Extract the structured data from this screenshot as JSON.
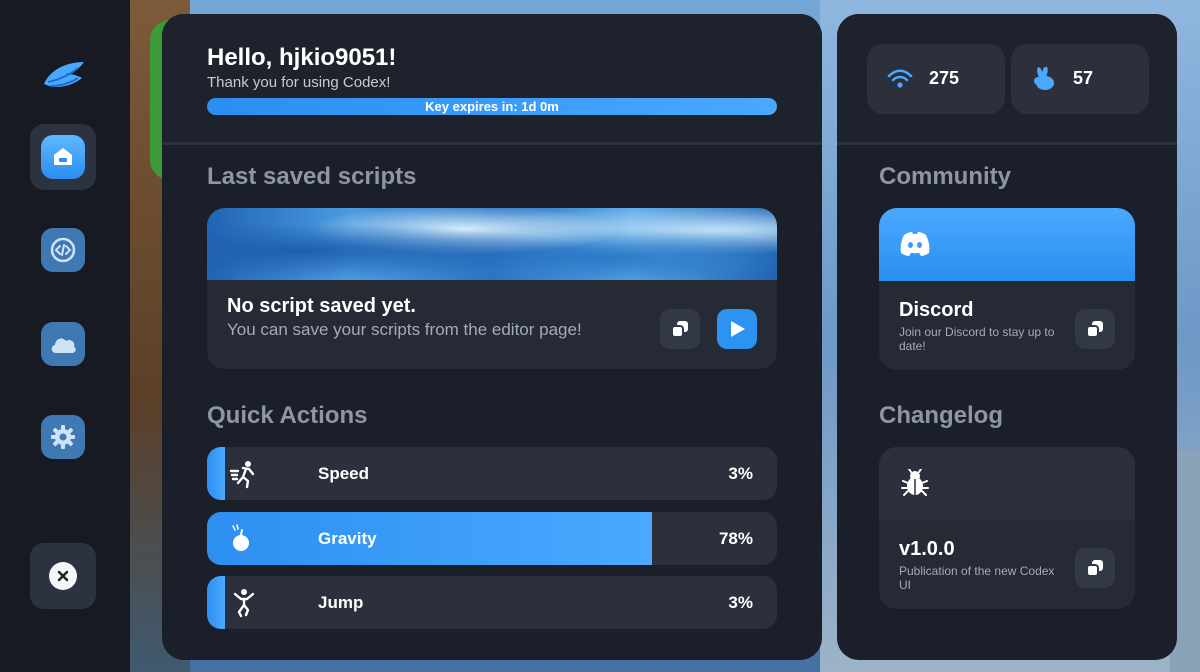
{
  "greeting": "Hello, hjkio9051!",
  "thanks": "Thank you for using Codex!",
  "key_expiry": "Key expires in: 1d 0m",
  "sections": {
    "last_saved": "Last saved scripts",
    "quick_actions": "Quick Actions",
    "community": "Community",
    "changelog": "Changelog"
  },
  "script_card": {
    "title": "No script saved yet.",
    "hint": "You can save your scripts from the editor page!"
  },
  "quick_actions": [
    {
      "label": "Speed",
      "value": "3%",
      "level": 0.03,
      "icon": "running-icon"
    },
    {
      "label": "Gravity",
      "value": "78%",
      "level": 0.78,
      "icon": "apple-icon"
    },
    {
      "label": "Jump",
      "value": "3%",
      "level": 0.03,
      "icon": "jumping-icon"
    }
  ],
  "stats": {
    "ping": "275",
    "fps": "57"
  },
  "discord": {
    "title": "Discord",
    "desc": "Join our Discord to stay up to date!"
  },
  "changelog_card": {
    "title": "v1.0.0",
    "desc": "Publication of the new Codex UI"
  },
  "nav_items": [
    "home-icon",
    "code-icon",
    "cloud-icon",
    "gear-icon"
  ],
  "colors": {
    "accent": "#2d93f1",
    "panel": "#1b1f29",
    "card": "#2b303c",
    "sidebar": "#171a22"
  }
}
